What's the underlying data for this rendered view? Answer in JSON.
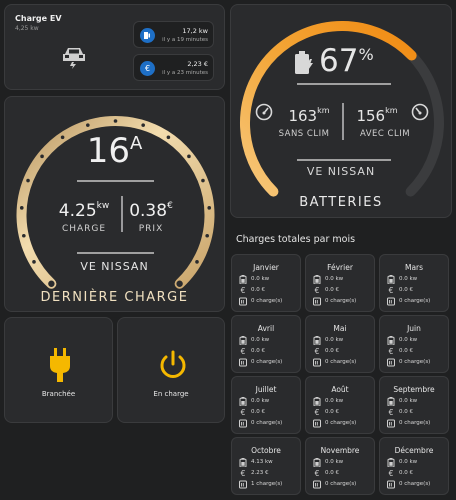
{
  "charge_ev": {
    "title": "Charge EV",
    "power": "4,25 kw",
    "energy_value": "17,2 kw",
    "energy_time": "il y a 19 minutes",
    "cost_value": "2,23 €",
    "cost_time": "il y a 23 minutes"
  },
  "last_charge": {
    "amps": "16",
    "amps_unit": "A",
    "power": "4.25",
    "power_unit": "kw",
    "power_label": "CHARGE",
    "price": "0.38",
    "price_unit": "€",
    "price_label": "PRIX",
    "vehicle": "VE NISSAN",
    "title": "DERNIÈRE CHARGE"
  },
  "battery": {
    "percent": "67",
    "percent_unit": "%",
    "percent_value": 67,
    "range_noac": "163",
    "range_noac_unit": "km",
    "range_noac_label": "SANS CLIM",
    "range_ac": "156",
    "range_ac_unit": "km",
    "range_ac_label": "AVEC CLIM",
    "vehicle": "VE NISSAN",
    "title": "BATTERIES"
  },
  "status": {
    "plug_label": "Branchée",
    "charging_label": "En charge"
  },
  "monthly": {
    "title": "Charges totales par mois",
    "months": [
      {
        "name": "Janvier",
        "kw": "0.0 kw",
        "eur": "0.0 €",
        "count": "0 charge(s)"
      },
      {
        "name": "Février",
        "kw": "0.0 kw",
        "eur": "0.0 €",
        "count": "0 charge(s)"
      },
      {
        "name": "Mars",
        "kw": "0.0 kw",
        "eur": "0.0 €",
        "count": "0 charge(s)"
      },
      {
        "name": "Avril",
        "kw": "0.0 kw",
        "eur": "0.0 €",
        "count": "0 charge(s)"
      },
      {
        "name": "Mai",
        "kw": "0.0 kw",
        "eur": "0.0 €",
        "count": "0 charge(s)"
      },
      {
        "name": "Juin",
        "kw": "0.0 kw",
        "eur": "0.0 €",
        "count": "0 charge(s)"
      },
      {
        "name": "Juillet",
        "kw": "0.0 kw",
        "eur": "0.0 €",
        "count": "0 charge(s)"
      },
      {
        "name": "Août",
        "kw": "0.0 kw",
        "eur": "0.0 €",
        "count": "0 charge(s)"
      },
      {
        "name": "Septembre",
        "kw": "0.0 kw",
        "eur": "0.0 €",
        "count": "0 charge(s)"
      },
      {
        "name": "Octobre",
        "kw": "4.13 kw",
        "eur": "2.23 €",
        "count": "1 charge(s)"
      },
      {
        "name": "Novembre",
        "kw": "0.0 kw",
        "eur": "0.0 €",
        "count": "0 charge(s)"
      },
      {
        "name": "Décembre",
        "kw": "0.0 kw",
        "eur": "0.0 €",
        "count": "0 charge(s)"
      }
    ]
  },
  "colors": {
    "background": "#1f2021",
    "card": "#2a2b2d",
    "gold": "#e8c98f",
    "orange": "#f39c12",
    "accent_blue": "#1e6fc6",
    "status_yellow": "#f5b800"
  }
}
